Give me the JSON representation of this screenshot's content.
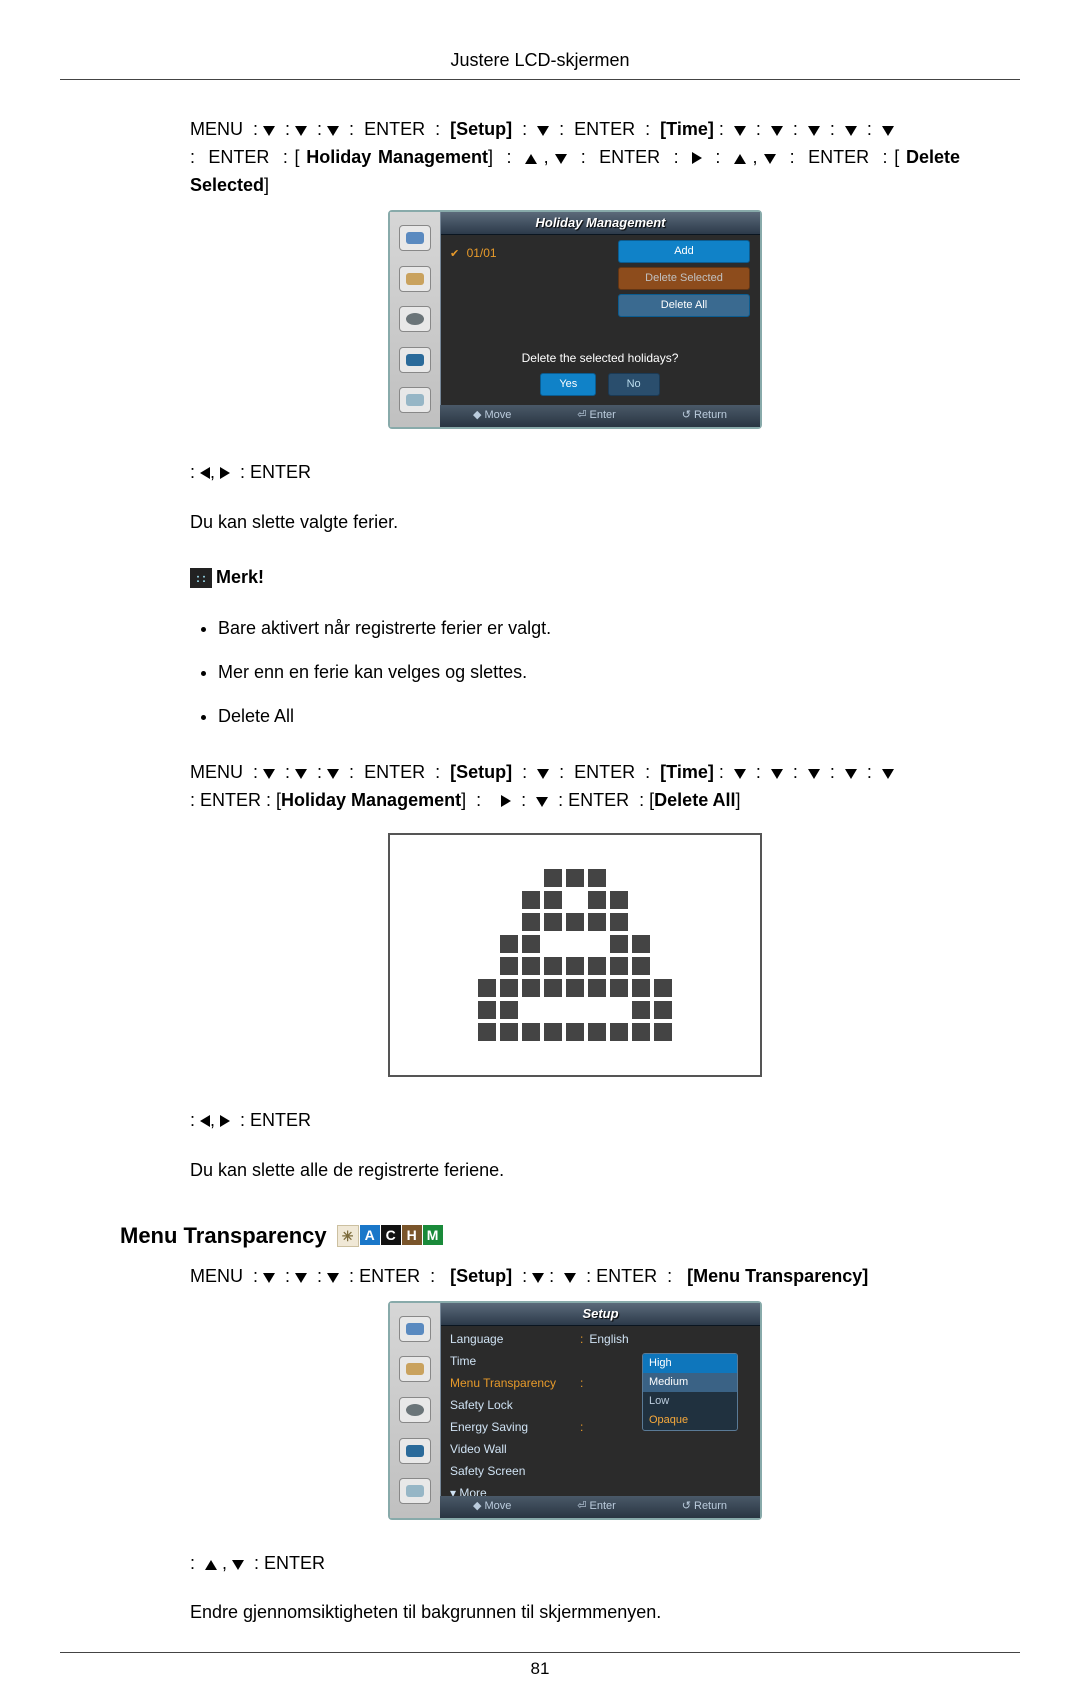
{
  "header": {
    "title": "Justere LCD-skjermen"
  },
  "nav1": {
    "parts": [
      "MENU",
      "ENTER",
      "[Setup]",
      "ENTER",
      "[Time]"
    ],
    "enter": "ENTER",
    "holiday": "Holiday Management",
    "delete_selected": "Delete Selected"
  },
  "osd_hm": {
    "title": "Holiday Management",
    "date": "01/01",
    "btn_add": "Add",
    "btn_delete_selected": "Delete Selected",
    "btn_delete_all": "Delete All",
    "prompt": "Delete the selected holidays?",
    "yes": "Yes",
    "no": "No",
    "footer_move": "Move",
    "footer_enter": "Enter",
    "footer_return": "Return"
  },
  "after_hm": {
    "action": "ENTER",
    "text": "Du kan slette valgte ferier.",
    "note_label": "Merk!",
    "bullet1": "Bare aktivert når registrerte ferier er valgt.",
    "bullet2": "Mer enn en ferie kan velges og slettes.",
    "bullet3": "Delete All"
  },
  "nav2": {
    "menu": "MENU",
    "enter": "ENTER",
    "setup": "[Setup]",
    "time": "[Time]",
    "holiday": "Holiday Management",
    "delete_all": "Delete All"
  },
  "after_da": {
    "action": "ENTER",
    "text": "Du kan slette alle de registrerte feriene."
  },
  "section_mt": {
    "heading": "Menu Transparency",
    "nav_menu": "MENU",
    "nav_enter": "ENTER",
    "nav_setup": "[Setup]",
    "nav_mt": "[Menu Transparency]"
  },
  "osd_setup": {
    "title": "Setup",
    "rows": {
      "language_label": "Language",
      "language_value": "English",
      "time_label": "Time",
      "mt_label": "Menu Transparency",
      "safety_lock_label": "Safety Lock",
      "energy_saving_label": "Energy Saving",
      "video_wall_label": "Video Wall",
      "safety_screen_label": "Safety Screen",
      "more_label": "More"
    },
    "dropdown": {
      "high": "High",
      "medium": "Medium",
      "low": "Low",
      "opaque": "Opaque"
    },
    "footer_move": "Move",
    "footer_enter": "Enter",
    "footer_return": "Return"
  },
  "after_mt": {
    "action": "ENTER",
    "text": "Endre gjennomsiktigheten til bakgrunnen til skjermmenyen."
  },
  "page_number": "81"
}
